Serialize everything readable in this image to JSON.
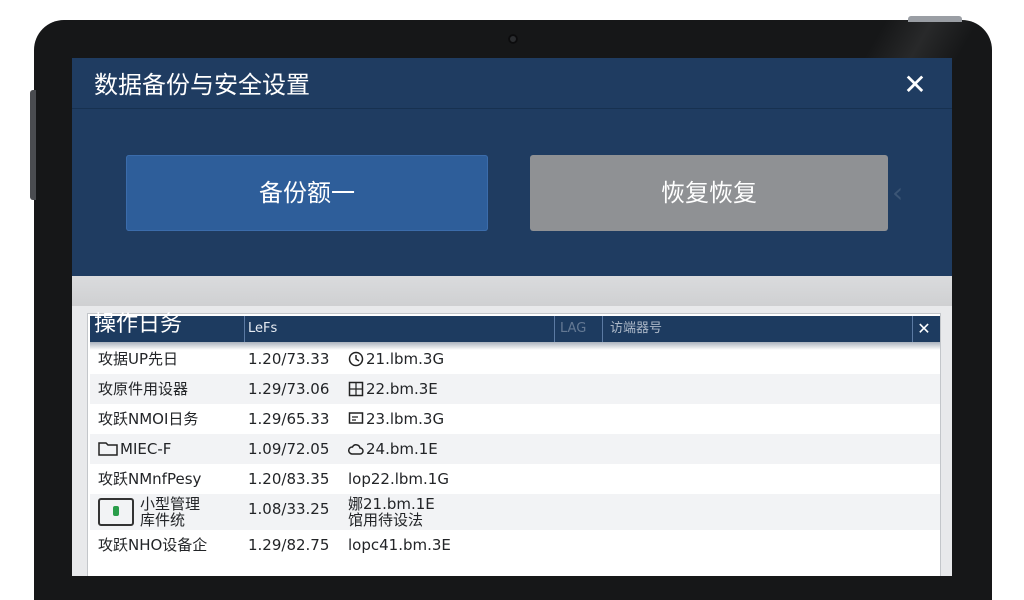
{
  "dialog": {
    "title": "数据备份与安全设置",
    "close_glyph": "✕"
  },
  "buttons": {
    "backup_label": "备份额一",
    "restore_label": "恢复恢复"
  },
  "log": {
    "title": "操作日务",
    "columns": [
      "LeFs",
      "LAG",
      "访端器号"
    ],
    "close_glyph": "✕",
    "rows": [
      {
        "name": "攻据UP先日",
        "value": "1.20/73.33",
        "icon": "clock-icon",
        "size": "21.lbm.3G"
      },
      {
        "name": "攻原件用设器",
        "value": "1.29/73.06",
        "icon": "grid-icon",
        "size": "22.bm.3E"
      },
      {
        "name": "攻跃NMOI日务",
        "value": "1.29/65.33",
        "icon": "monitor-icon",
        "size": "23.lbm.3G"
      },
      {
        "name": "MIEC-F",
        "value": "1.09/72.05",
        "icon": "cloud-icon",
        "size": "24.bm.1E"
      },
      {
        "name": "攻跃NMnfPesy",
        "value": "1.20/83.35",
        "icon": "",
        "size": "lop22.lbm.1G"
      },
      {
        "name": "小型管理",
        "name2": "库件统",
        "value": "1.08/33.25",
        "icon": "",
        "size": "娜21.bm.1E",
        "size2": "馆用待设法"
      },
      {
        "name": "攻跃NHO设备企",
        "value": "1.29/82.75",
        "icon": "",
        "size": "lopc41.bm.3E"
      }
    ]
  }
}
